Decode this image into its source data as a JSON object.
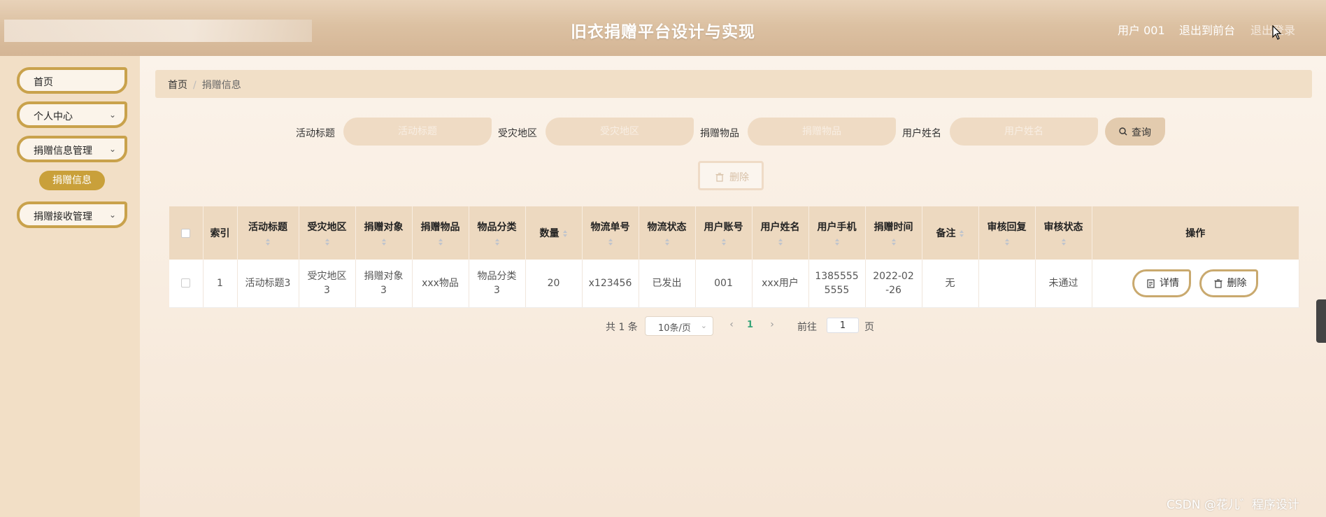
{
  "header": {
    "title": "旧衣捐赠平台设计与实现",
    "user_label": "用户 001",
    "to_front": "退出到前台",
    "logout": "退出登录"
  },
  "sidebar": {
    "items": [
      {
        "label": "首页"
      },
      {
        "label": "个人中心"
      },
      {
        "label": "捐赠信息管理"
      },
      {
        "label": "捐赠接收管理"
      }
    ],
    "active_sub": "捐赠信息"
  },
  "breadcrumb": {
    "home": "首页",
    "separator": "/",
    "current": "捐赠信息"
  },
  "search": {
    "fields": [
      {
        "label": "活动标题",
        "placeholder": "活动标题"
      },
      {
        "label": "受灾地区",
        "placeholder": "受灾地区"
      },
      {
        "label": "捐赠物品",
        "placeholder": "捐赠物品"
      },
      {
        "label": "用户姓名",
        "placeholder": "用户姓名"
      }
    ],
    "button": "查询"
  },
  "toolbar": {
    "delete_label": "删除"
  },
  "table": {
    "headers": [
      "索引",
      "活动标题",
      "受灾地区",
      "捐赠对象",
      "捐赠物品",
      "物品分类",
      "数量",
      "物流单号",
      "物流状态",
      "用户账号",
      "用户姓名",
      "用户手机",
      "捐赠时间",
      "备注",
      "审核回复",
      "审核状态",
      "操作"
    ],
    "rows": [
      {
        "index": "1",
        "title": "活动标题3",
        "region_a": "受灾地区",
        "region_b": "3",
        "target_a": "捐赠对象",
        "target_b": "3",
        "item": "xxx物品",
        "category_a": "物品分类",
        "category_b": "3",
        "quantity": "20",
        "tracking": "x123456",
        "logistics_status": "已发出",
        "account": "001",
        "name": "xxx用户",
        "phone_a": "1385555",
        "phone_b": "5555",
        "time_a": "2022-02",
        "time_b": "-26",
        "remark": "无",
        "reply": "",
        "review_status": "未通过",
        "detail_label": "详情",
        "delete_label": "删除"
      }
    ]
  },
  "pagination": {
    "total": "共 1 条",
    "page_size": "10条/页",
    "current_page": "1",
    "goto_label": "前往",
    "goto_value": "1",
    "page_unit": "页"
  },
  "watermark": "CSDN @花儿゛程序设计",
  "colors": {
    "accent": "#c9a24c",
    "header": "#d9bb9c",
    "sidebar": "#f2dfc6",
    "header_cell": "#edd9c0",
    "page_active": "#3aa57a"
  }
}
